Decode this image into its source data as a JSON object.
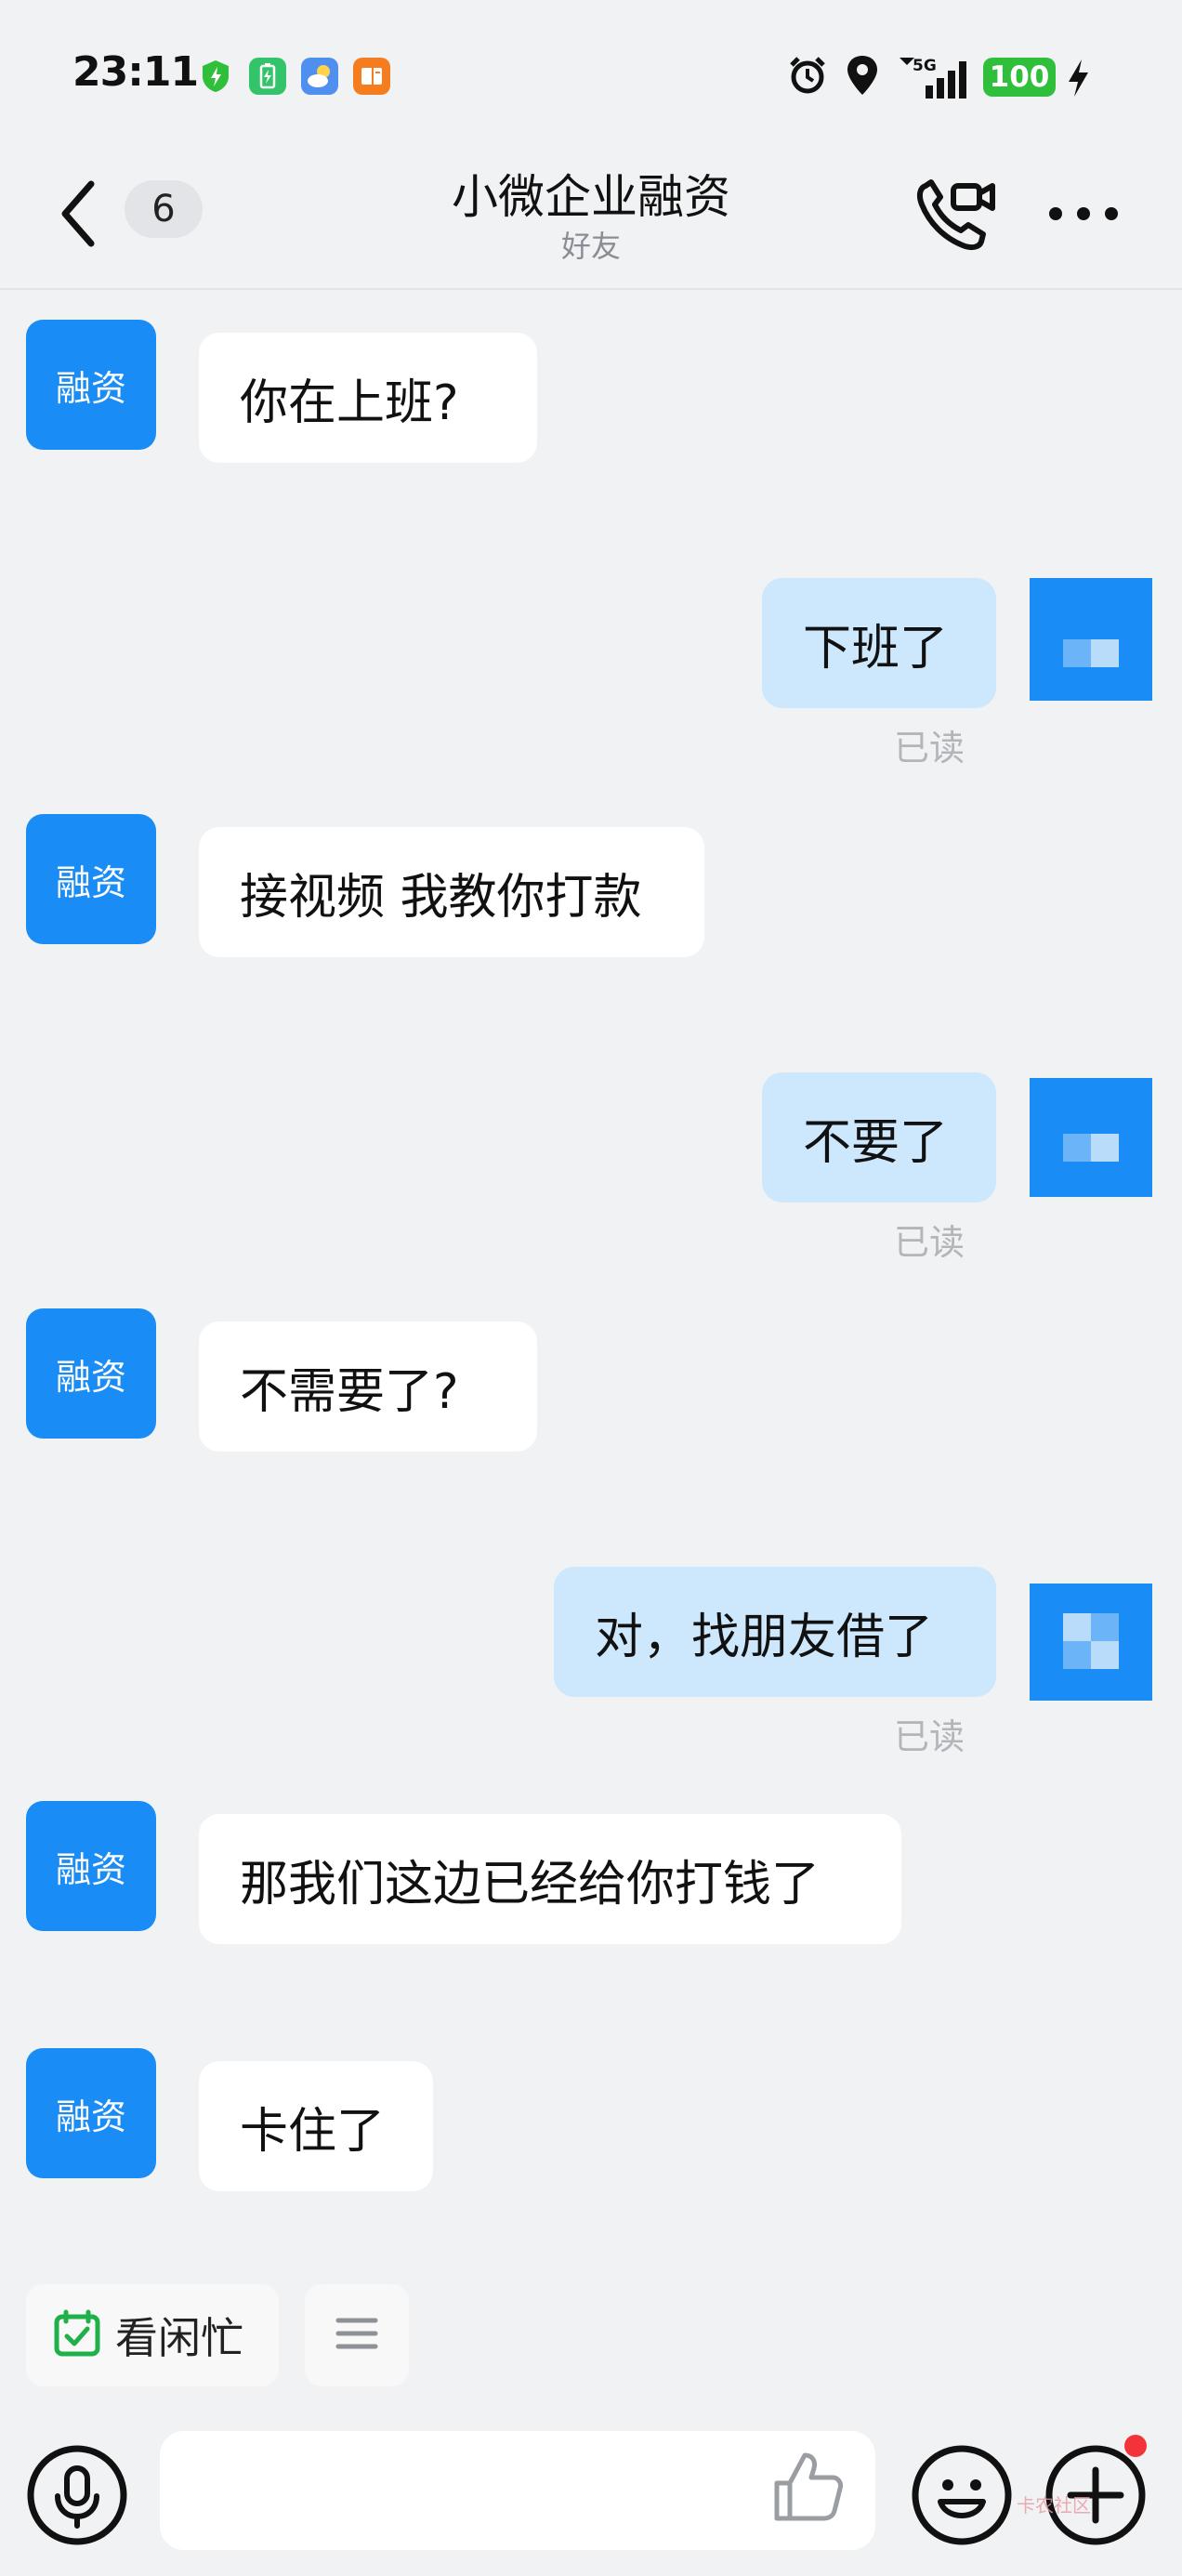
{
  "status_bar": {
    "time": "23:11",
    "network": "5G",
    "battery": "100",
    "icons": [
      "security-shield-icon",
      "battery-app-icon",
      "weather-icon",
      "reader-app-icon",
      "alarm-icon",
      "location-icon",
      "signal-icon",
      "charging-icon"
    ]
  },
  "nav": {
    "unread_count": "6",
    "title": "小微企业融资",
    "subtitle": "好友",
    "icons": [
      "back-icon",
      "voice-video-call-icon",
      "more-icon"
    ]
  },
  "contact": {
    "avatar_text": "融资",
    "avatar_color": "#1a8cf5"
  },
  "messages": [
    {
      "from": "contact",
      "text": "你在上班?"
    },
    {
      "from": "me",
      "text": "下班了",
      "status": "已读"
    },
    {
      "from": "contact",
      "text": "接视频 我教你打款"
    },
    {
      "from": "me",
      "text": "不要了",
      "status": "已读"
    },
    {
      "from": "contact",
      "text": "不需要了?"
    },
    {
      "from": "me",
      "text": "对，找朋友借了",
      "status": "已读"
    },
    {
      "from": "contact",
      "text": "那我们这边已经给你打钱了"
    },
    {
      "from": "contact",
      "text": "卡住了"
    }
  ],
  "quick_actions": {
    "busy_status_label": "看闲忙"
  },
  "input_bar": {
    "placeholder": "",
    "icons": [
      "microphone-icon",
      "thumbs-up-icon",
      "emoji-icon",
      "plus-icon"
    ]
  },
  "watermark": "卡农社区"
}
